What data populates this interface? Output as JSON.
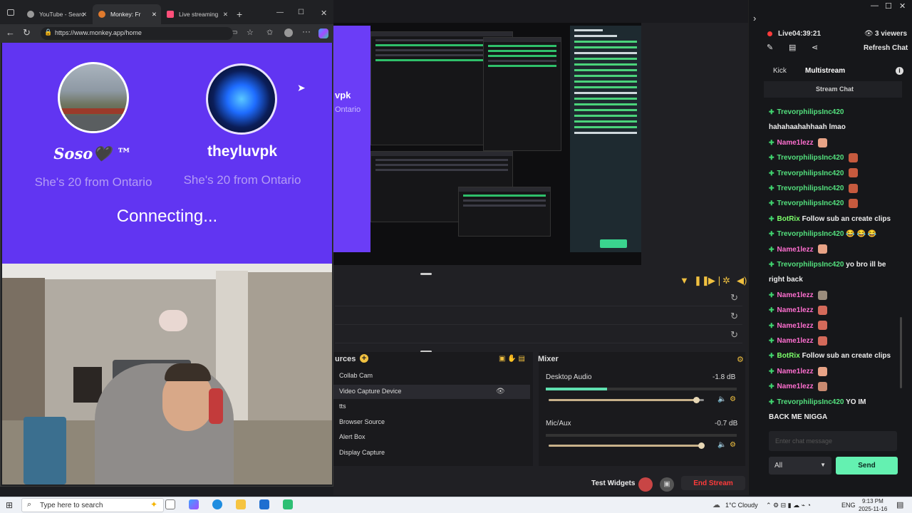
{
  "browser": {
    "tabs": [
      {
        "label": "YouTube - Searc",
        "color": "#ff3d3d"
      },
      {
        "label": "Monkey: Fr",
        "color": "#e07a2d"
      },
      {
        "label": "Live streaming",
        "color": "#ff4f7a"
      }
    ],
    "url": "https://www.monkey.app/home",
    "monkey": {
      "user1_name": "𝑺𝒐𝒔𝒐🖤 ™",
      "user1_bio": "She's 20 from Ontario",
      "user2_name": "theyluvpk",
      "user2_bio": "She's 20 from Ontario",
      "status": "Connecting..."
    }
  },
  "obs": {
    "preview_name": "vpk",
    "preview_bio": "Ontario",
    "sources_title": "urces",
    "mixer_title": "Mixer",
    "sources": [
      "Collab Cam",
      "Video Capture Device",
      "tts",
      "Browser Source",
      "Alert Box",
      "Display Capture"
    ],
    "mixer": [
      {
        "name": "Desktop Audio",
        "db": "-1.8 dB",
        "level": 0.95
      },
      {
        "name": "Mic/Aux",
        "db": "-0.7 dB",
        "level": 0.98
      }
    ],
    "test_widgets": "Test Widgets",
    "end_stream": "End Stream"
  },
  "chat": {
    "live_time": "Live04:39:21",
    "viewers": "3 viewers",
    "refresh": "Refresh Chat",
    "tab_kick": "Kick",
    "tab_multistream": "Multistream",
    "stream_chat": "Stream Chat",
    "messages": [
      {
        "user": "TrevorphilipsInc420",
        "text": "",
        "type": "green"
      },
      {
        "user": "",
        "text": "hahahaahahhaah lmao",
        "type": "plain"
      },
      {
        "user": "Name1lezz",
        "text": "",
        "type": "pink",
        "emote": "#e8a386"
      },
      {
        "user": "TrevorphilipsInc420",
        "text": "",
        "type": "green",
        "emote": "#c65a3e"
      },
      {
        "user": "TrevorphilipsInc420",
        "text": "",
        "type": "green",
        "emote": "#c65a3e"
      },
      {
        "user": "TrevorphilipsInc420",
        "text": "",
        "type": "green",
        "emote": "#c65a3e"
      },
      {
        "user": "TrevorphilipsInc420",
        "text": "",
        "type": "green",
        "emote": "#c65a3e"
      },
      {
        "user": "BotRix",
        "text": "Follow sub an create clips",
        "type": "bot"
      },
      {
        "user": "TrevorphilipsInc420",
        "text": "😂 😂 😂",
        "type": "green"
      },
      {
        "user": "Name1lezz",
        "text": "",
        "type": "pink",
        "emote": "#e8a386"
      },
      {
        "user": "TrevorphilipsInc420",
        "text": "yo bro ill be",
        "type": "green"
      },
      {
        "user": "",
        "text": "right back",
        "type": "plain"
      },
      {
        "user": "Name1lezz",
        "text": "",
        "type": "pink",
        "emote": "#9a8c7c"
      },
      {
        "user": "Name1lezz",
        "text": "",
        "type": "pink",
        "emote": "#d46a5a"
      },
      {
        "user": "Name1lezz",
        "text": "",
        "type": "pink",
        "emote": "#d46a5a"
      },
      {
        "user": "Name1lezz",
        "text": "",
        "type": "pink",
        "emote": "#d46a5a"
      },
      {
        "user": "BotRix",
        "text": "Follow sub an create clips",
        "type": "bot"
      },
      {
        "user": "Name1lezz",
        "text": "",
        "type": "pink",
        "emote": "#e8a386"
      },
      {
        "user": "Name1lezz",
        "text": "",
        "type": "pink",
        "emote": "#c98a70"
      },
      {
        "user": "TrevorphilipsInc420",
        "text": "YO IM",
        "type": "green"
      },
      {
        "user": "",
        "text": "BACK ME NIGGA",
        "type": "plain"
      }
    ],
    "input_placeholder": "Enter chat message",
    "filter": "All",
    "send": "Send"
  },
  "taskbar": {
    "search_placeholder": "Type here to search",
    "weather": "1°C  Cloudy",
    "lang": "ENG",
    "time": "9:13 PM",
    "date": "2025-11-16"
  }
}
